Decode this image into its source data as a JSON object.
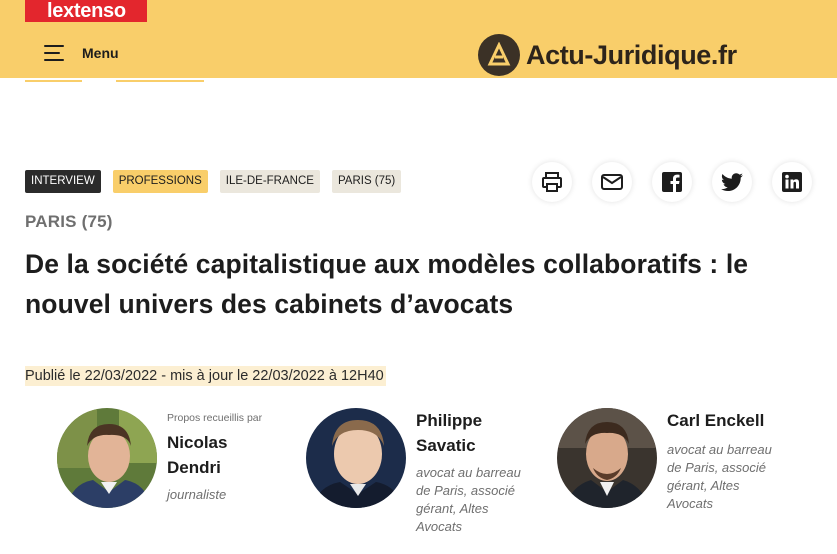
{
  "header": {
    "publisher_logo": "lextenso",
    "menu_label": "Menu",
    "site_name": "Actu-Juridique.fr",
    "brand_color": "#f9ce6a",
    "publisher_color": "#e3262d"
  },
  "article": {
    "tags": [
      "INTERVIEW",
      "PROFESSIONS",
      "ILE-DE-FRANCE",
      "PARIS (75)"
    ],
    "location": "PARIS (75)",
    "title_line1": "De la société capitalistique aux modèles collaboratifs : le",
    "title_line2": "nouvel univers des cabinets d’avocats",
    "published": "Publié le 22/03/2022 - mis à jour le 22/03/2022 à 12H40"
  },
  "share": {
    "icons": [
      "print-icon",
      "mail-icon",
      "facebook-icon",
      "twitter-icon",
      "linkedin-icon"
    ]
  },
  "authors": [
    {
      "kicker": "Propos recueillis par",
      "name_line1": "Nicolas",
      "name_line2": "Dendri",
      "role_lines": [
        "journaliste"
      ]
    },
    {
      "kicker": "",
      "name_line1": "Philippe",
      "name_line2": "Savatic",
      "role_lines": [
        "avocat au barreau",
        "de Paris, associé",
        "gérant, Altes",
        "Avocats"
      ]
    },
    {
      "kicker": "",
      "name_line1": "Carl Enckell",
      "name_line2": "",
      "role_lines": [
        "avocat au barreau",
        "de Paris, associé",
        "gérant, Altes",
        "Avocats"
      ]
    }
  ]
}
